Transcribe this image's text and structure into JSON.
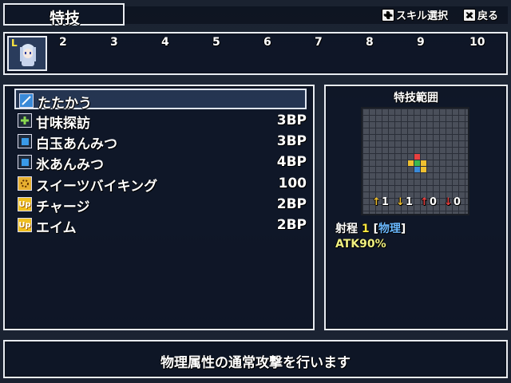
{
  "header": {
    "title": "特技",
    "skill_select_label": "スキル選択",
    "back_label": "戻る"
  },
  "party": {
    "slot1_label": "L",
    "slots": [
      "2",
      "3",
      "4",
      "5",
      "6",
      "7",
      "8",
      "9",
      "10"
    ]
  },
  "skills": [
    {
      "name": "たたかう",
      "cost": "",
      "icon": "sword-icon",
      "icon_color": "#3a8ad8"
    },
    {
      "name": "甘味探訪",
      "cost": "3BP",
      "icon": "plus-icon",
      "icon_color": "#8ad850"
    },
    {
      "name": "白玉あんみつ",
      "cost": "3BP",
      "icon": "square-icon",
      "icon_color": "#3a9ae8"
    },
    {
      "name": "氷あんみつ",
      "cost": "4BP",
      "icon": "square-icon",
      "icon_color": "#3a9ae8"
    },
    {
      "name": "スイーツバイキング",
      "cost": "100",
      "icon": "special-icon",
      "icon_color": "#e8b030"
    },
    {
      "name": "チャージ",
      "cost": "2BP",
      "icon": "up-icon",
      "icon_color": "#f0c020"
    },
    {
      "name": "エイム",
      "cost": "2BP",
      "icon": "up-icon",
      "icon_color": "#f0c020"
    }
  ],
  "range_panel": {
    "title": "特技範囲",
    "stats": [
      {
        "arrow": "↑",
        "color": "#f0c030",
        "value": "1"
      },
      {
        "arrow": "↓",
        "color": "#f0c030",
        "value": "1"
      },
      {
        "arrow": "↑",
        "color": "#e84040",
        "value": "0"
      },
      {
        "arrow": "↓",
        "color": "#e84040",
        "value": "0"
      }
    ],
    "range_label": "射程",
    "range_value": "1",
    "range_type_open": "[",
    "range_type": "物理",
    "range_type_close": "]",
    "atk_text": "ATK90%"
  },
  "description": "物理属性の通常攻撃を行います",
  "colors": {
    "accent_yellow": "#ffe840",
    "physical_blue": "#6ab8ff",
    "atk_yellow": "#f0f080"
  }
}
